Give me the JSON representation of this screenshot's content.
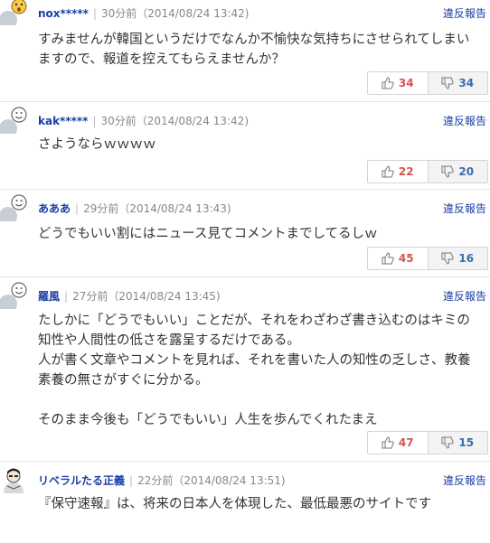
{
  "comments": [
    {
      "user": "nox*****",
      "time": "30分前（2014/08/24 13:42)",
      "report": "違反報告",
      "lines": [
        "すみませんが韓国というだけでなんか不愉快な気持ちにさせられてしまい",
        "ますので、報道を控えてもらえませんか？"
      ],
      "good": "34",
      "bad": "34",
      "avatar": "surprised-face-icon"
    },
    {
      "user": "kak*****",
      "time": "30分前（2014/08/24 13:42)",
      "report": "違反報告",
      "lines": [
        "さようならｗｗｗｗ"
      ],
      "good": "22",
      "bad": "20",
      "avatar": "smile-face-icon"
    },
    {
      "user": "あああ",
      "time": "29分前（2014/08/24 13:43)",
      "report": "違反報告",
      "lines": [
        "どうでもいい割にはニュース見てコメントまでしてるしｗ"
      ],
      "good": "45",
      "bad": "16",
      "avatar": "smile-face-icon"
    },
    {
      "user": "羅風",
      "time": "27分前（2014/08/24 13:45)",
      "report": "違反報告",
      "lines": [
        "たしかに「どうでもいい」ことだが、それをわざわざ書き込むのはキミの",
        "知性や人間性の低さを露呈するだけである。",
        "人が書く文章やコメントを見れば、それを書いた人の知性の乏しさ、教養",
        "素養の無さがすぐに分かる。",
        "",
        "そのまま今後も「どうでもいい」人生を歩んでくれたまえ"
      ],
      "good": "47",
      "bad": "15",
      "avatar": "smile-face-icon"
    },
    {
      "user": "リベラルたる正義",
      "time": "22分前（2014/08/24 13:51)",
      "report": "違反報告",
      "lines": [
        "『保守速報』は、将来の日本人を体現した、最低最悪のサイトです"
      ],
      "avatar": "user-photo-avatar"
    }
  ]
}
